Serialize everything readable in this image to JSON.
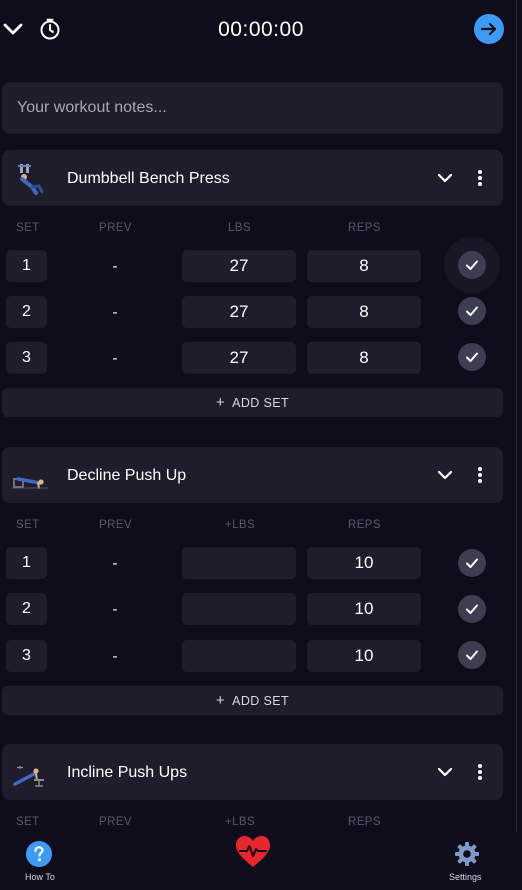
{
  "topbar": {
    "collapse_icon": "chevron-down-icon",
    "timer_icon": "stopwatch-icon",
    "elapsed": "00:00:00",
    "finish_icon": "arrow-right-icon",
    "accent": "#3d9bf5"
  },
  "notes": {
    "placeholder": "Your workout notes..."
  },
  "exercises": [
    {
      "name": "Dumbbell Bench Press",
      "columns": [
        "SET",
        "PREV",
        "LBS",
        "REPS"
      ],
      "sets": [
        {
          "set": "1",
          "prev": "-",
          "weight": "27",
          "reps": "8",
          "done": true
        },
        {
          "set": "2",
          "prev": "-",
          "weight": "27",
          "reps": "8",
          "done": true
        },
        {
          "set": "3",
          "prev": "-",
          "weight": "27",
          "reps": "8",
          "done": true
        }
      ],
      "add_set": "ADD SET"
    },
    {
      "name": "Decline Push Up",
      "columns": [
        "SET",
        "PREV",
        "+LBS",
        "REPS"
      ],
      "sets": [
        {
          "set": "1",
          "prev": "-",
          "weight": "",
          "reps": "10",
          "done": true
        },
        {
          "set": "2",
          "prev": "-",
          "weight": "",
          "reps": "10",
          "done": true
        },
        {
          "set": "3",
          "prev": "-",
          "weight": "",
          "reps": "10",
          "done": true
        }
      ],
      "add_set": "ADD SET"
    },
    {
      "name": "Incline Push Ups",
      "columns": [
        "SET",
        "PREV",
        "+LBS",
        "REPS"
      ]
    }
  ],
  "bottom_nav": {
    "how_to": {
      "label": "How To",
      "icon": "help-icon"
    },
    "center": {
      "icon": "heart-pulse-icon",
      "color": "#e8262e"
    },
    "settings": {
      "label": "Settings",
      "icon": "gear-icon"
    }
  }
}
